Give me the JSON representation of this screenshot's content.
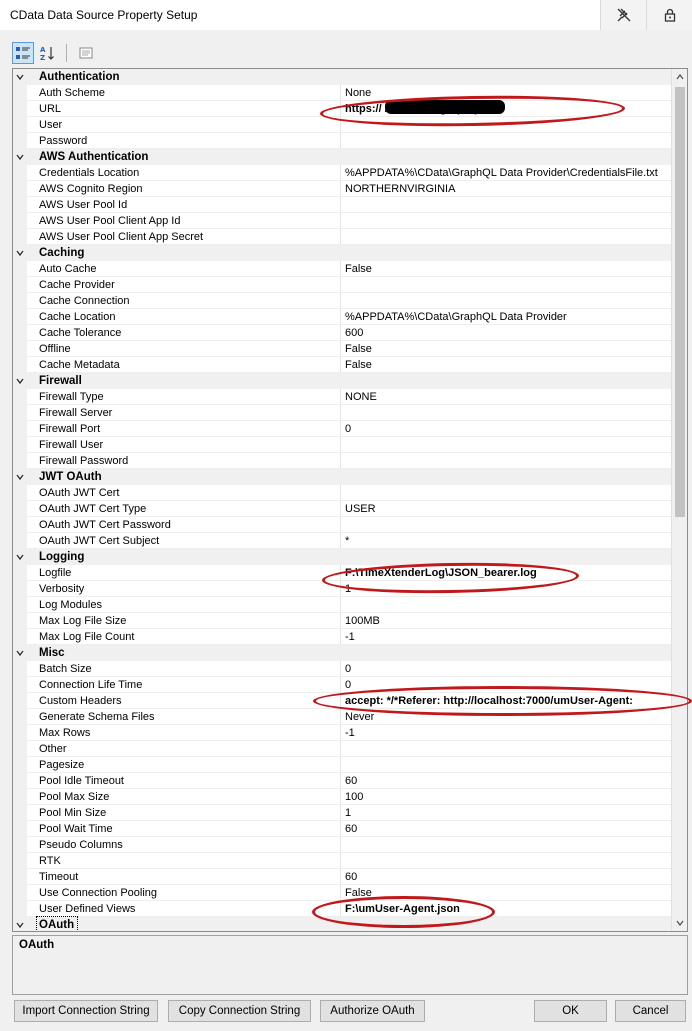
{
  "window": {
    "title": "CData Data Source Property Setup"
  },
  "colors": {
    "annotation": "#c0181b",
    "selected": "#cce4f7"
  },
  "title_tools": [
    {
      "icon": "pin-off-icon"
    },
    {
      "icon": "lock-icon"
    }
  ],
  "toolbar": [
    {
      "icon": "categorized-view-icon",
      "active": true
    },
    {
      "icon": "alphabetical-sort-icon",
      "active": false
    },
    {
      "icon": "property-pages-icon",
      "active": false
    }
  ],
  "grid": {
    "rows": [
      {
        "type": "category",
        "label": "Authentication"
      },
      {
        "type": "prop",
        "name": "Auth Scheme",
        "value": "None"
      },
      {
        "type": "prop",
        "name": "URL",
        "value": "https://                              /um/users/graphql",
        "bold": true
      },
      {
        "type": "prop",
        "name": "User",
        "value": ""
      },
      {
        "type": "prop",
        "name": "Password",
        "value": ""
      },
      {
        "type": "category",
        "label": "AWS Authentication"
      },
      {
        "type": "prop",
        "name": "Credentials Location",
        "value": "%APPDATA%\\CData\\GraphQL Data Provider\\CredentialsFile.txt"
      },
      {
        "type": "prop",
        "name": "AWS Cognito Region",
        "value": "NORTHERNVIRGINIA"
      },
      {
        "type": "prop",
        "name": "AWS User Pool Id",
        "value": ""
      },
      {
        "type": "prop",
        "name": "AWS User Pool Client App Id",
        "value": ""
      },
      {
        "type": "prop",
        "name": "AWS User Pool Client App Secret",
        "value": ""
      },
      {
        "type": "category",
        "label": "Caching"
      },
      {
        "type": "prop",
        "name": "Auto Cache",
        "value": "False"
      },
      {
        "type": "prop",
        "name": "Cache Provider",
        "value": ""
      },
      {
        "type": "prop",
        "name": "Cache Connection",
        "value": ""
      },
      {
        "type": "prop",
        "name": "Cache Location",
        "value": "%APPDATA%\\CData\\GraphQL Data Provider"
      },
      {
        "type": "prop",
        "name": "Cache Tolerance",
        "value": "600"
      },
      {
        "type": "prop",
        "name": "Offline",
        "value": "False"
      },
      {
        "type": "prop",
        "name": "Cache Metadata",
        "value": "False"
      },
      {
        "type": "category",
        "label": "Firewall"
      },
      {
        "type": "prop",
        "name": "Firewall Type",
        "value": "NONE"
      },
      {
        "type": "prop",
        "name": "Firewall Server",
        "value": ""
      },
      {
        "type": "prop",
        "name": "Firewall Port",
        "value": "0"
      },
      {
        "type": "prop",
        "name": "Firewall User",
        "value": ""
      },
      {
        "type": "prop",
        "name": "Firewall Password",
        "value": ""
      },
      {
        "type": "category",
        "label": "JWT OAuth"
      },
      {
        "type": "prop",
        "name": "OAuth JWT Cert",
        "value": ""
      },
      {
        "type": "prop",
        "name": "OAuth JWT Cert Type",
        "value": "USER"
      },
      {
        "type": "prop",
        "name": "OAuth JWT Cert Password",
        "value": ""
      },
      {
        "type": "prop",
        "name": "OAuth JWT Cert Subject",
        "value": "*"
      },
      {
        "type": "category",
        "label": "Logging"
      },
      {
        "type": "prop",
        "name": "Logfile",
        "value": "F:\\TimeXtenderLog\\JSON_bearer.log",
        "bold": true
      },
      {
        "type": "prop",
        "name": "Verbosity",
        "value": "1"
      },
      {
        "type": "prop",
        "name": "Log Modules",
        "value": ""
      },
      {
        "type": "prop",
        "name": "Max Log File Size",
        "value": "100MB"
      },
      {
        "type": "prop",
        "name": "Max Log File Count",
        "value": "-1"
      },
      {
        "type": "category",
        "label": "Misc"
      },
      {
        "type": "prop",
        "name": "Batch Size",
        "value": "0"
      },
      {
        "type": "prop",
        "name": "Connection Life Time",
        "value": "0"
      },
      {
        "type": "prop",
        "name": "Custom Headers",
        "value": "accept: */*Referer: http://localhost:7000/umUser-Agent:",
        "bold": true
      },
      {
        "type": "prop",
        "name": "Generate Schema Files",
        "value": "Never"
      },
      {
        "type": "prop",
        "name": "Max Rows",
        "value": "-1"
      },
      {
        "type": "prop",
        "name": "Other",
        "value": ""
      },
      {
        "type": "prop",
        "name": "Pagesize",
        "value": ""
      },
      {
        "type": "prop",
        "name": "Pool Idle Timeout",
        "value": "60"
      },
      {
        "type": "prop",
        "name": "Pool Max Size",
        "value": "100"
      },
      {
        "type": "prop",
        "name": "Pool Min Size",
        "value": "1"
      },
      {
        "type": "prop",
        "name": "Pool Wait Time",
        "value": "60"
      },
      {
        "type": "prop",
        "name": "Pseudo Columns",
        "value": ""
      },
      {
        "type": "prop",
        "name": "RTK",
        "value": ""
      },
      {
        "type": "prop",
        "name": "Timeout",
        "value": "60"
      },
      {
        "type": "prop",
        "name": "Use Connection Pooling",
        "value": "False"
      },
      {
        "type": "prop",
        "name": "User Defined Views",
        "value": "F:\\umUser-Agent.json",
        "bold": true
      },
      {
        "type": "category",
        "label": "OAuth",
        "selected": true
      }
    ]
  },
  "description": {
    "title": "OAuth"
  },
  "buttons": {
    "import": "Import Connection String",
    "copy": "Copy Connection String",
    "authorize": "Authorize OAuth",
    "ok": "OK",
    "cancel": "Cancel"
  }
}
